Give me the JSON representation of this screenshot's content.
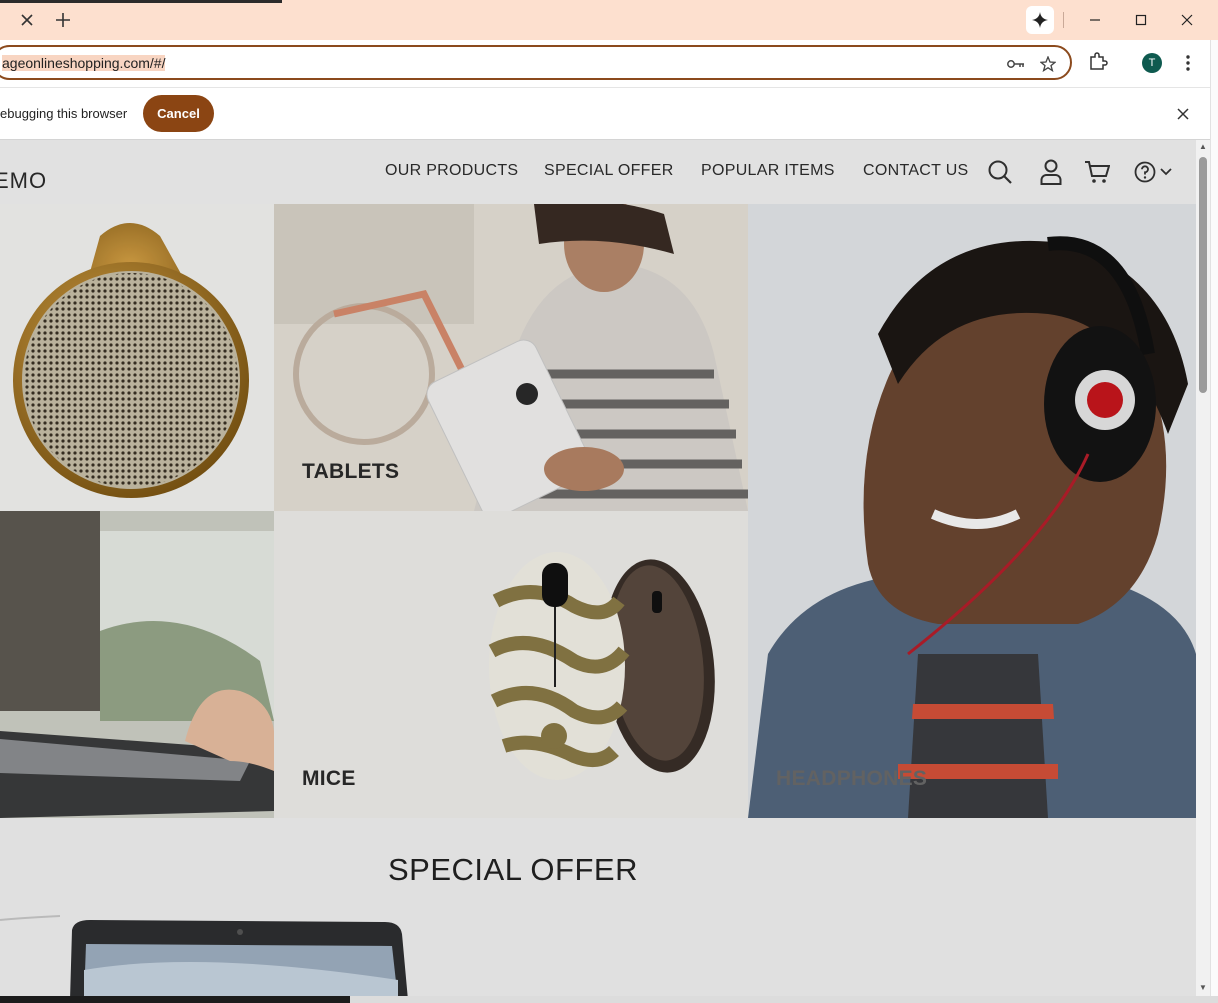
{
  "browser": {
    "address_url": "ageonlineshopping.com/#/",
    "profile_initial": "T",
    "infobar_text": "ebugging this browser",
    "infobar_cancel": "Cancel"
  },
  "site": {
    "logo": "EMO",
    "nav": [
      "OUR PRODUCTS",
      "SPECIAL OFFER",
      "POPULAR ITEMS",
      "CONTACT US"
    ],
    "categories": {
      "tablets": "TABLETS",
      "mice": "MICE",
      "headphones": "HEADPHONES"
    },
    "section_title": "SPECIAL OFFER"
  },
  "colors": {
    "tab_bg": "#fde0cf",
    "accent": "#8b4513",
    "page_bg": "#f2f2f2"
  },
  "icons": [
    "close-icon",
    "plus-icon",
    "gemini-icon",
    "minimize-icon",
    "maximize-icon",
    "key-icon",
    "star-icon",
    "extensions-icon",
    "menu-icon",
    "search-icon",
    "user-icon",
    "cart-icon",
    "help-icon",
    "chevron-down-icon"
  ]
}
